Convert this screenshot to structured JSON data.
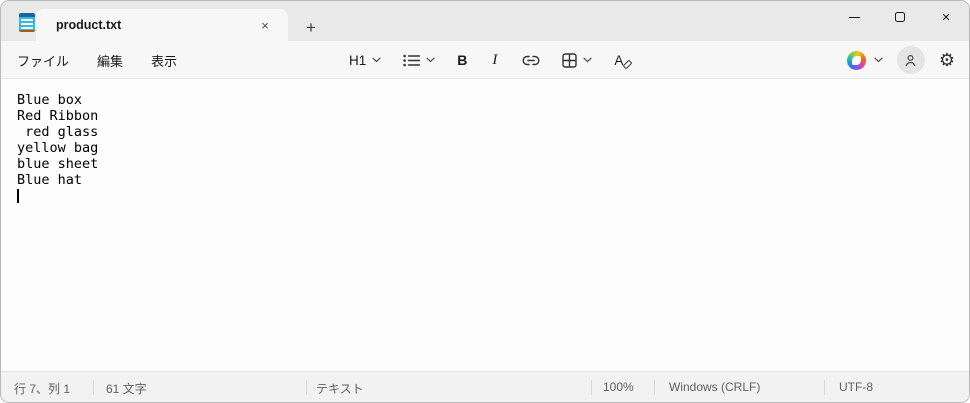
{
  "titlebar": {
    "tab_label": "product.txt",
    "icons": {
      "tab_close": "×",
      "new_tab": "+",
      "window_close": "×",
      "gear": "⚙"
    }
  },
  "menubar": {
    "items": [
      {
        "label": "ファイル"
      },
      {
        "label": "編集"
      },
      {
        "label": "表示"
      }
    ]
  },
  "toolbar": {
    "heading_label": "H1",
    "bold_label": "B",
    "italic_label": "I",
    "clear_format_label": "A"
  },
  "editor": {
    "lines": [
      "Blue box",
      "Red Ribbon",
      " red glass",
      "yellow bag",
      "blue sheet",
      "Blue hat"
    ]
  },
  "statusbar": {
    "cursor_position": "行 7、列 1",
    "char_count": "61 文字",
    "document_type": "テキスト",
    "zoom_level": "100%",
    "line_ending": "Windows (CRLF)",
    "encoding": "UTF-8"
  }
}
